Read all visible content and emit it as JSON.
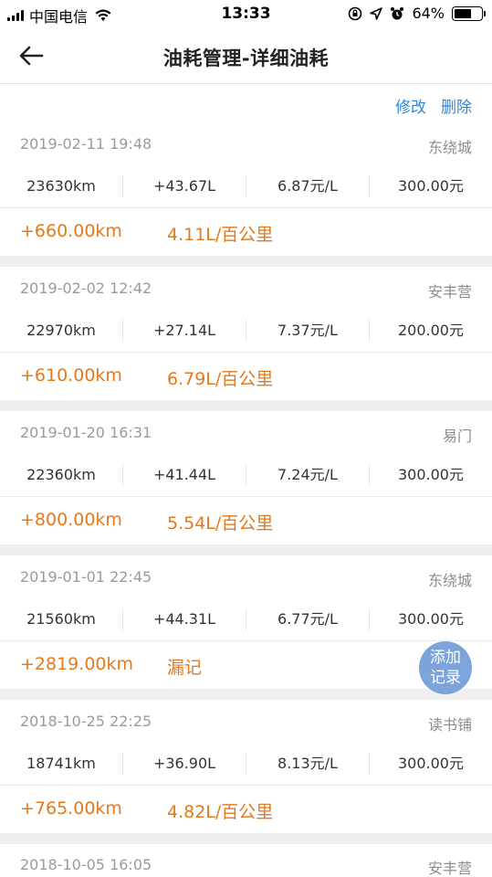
{
  "status_bar": {
    "carrier": "中国电信",
    "time": "13:33",
    "battery": "64%",
    "battery_level": 0.64
  },
  "header": {
    "title": "油耗管理-详细油耗"
  },
  "actions": {
    "edit": "修改",
    "delete": "删除"
  },
  "records": [
    {
      "datetime": "2019-02-11 19:48",
      "station": "东绕城",
      "odometer": "23630km",
      "fuel": "+43.67L",
      "price": "6.87元/L",
      "amount": "300.00元",
      "distance": "+660.00km",
      "consumption": "4.11L/百公里"
    },
    {
      "datetime": "2019-02-02 12:42",
      "station": "安丰营",
      "odometer": "22970km",
      "fuel": "+27.14L",
      "price": "7.37元/L",
      "amount": "200.00元",
      "distance": "+610.00km",
      "consumption": "6.79L/百公里"
    },
    {
      "datetime": "2019-01-20 16:31",
      "station": "易门",
      "odometer": "22360km",
      "fuel": "+41.44L",
      "price": "7.24元/L",
      "amount": "300.00元",
      "distance": "+800.00km",
      "consumption": "5.54L/百公里"
    },
    {
      "datetime": "2019-01-01 22:45",
      "station": "东绕城",
      "odometer": "21560km",
      "fuel": "+44.31L",
      "price": "6.77元/L",
      "amount": "300.00元",
      "distance": "+2819.00km",
      "consumption": "漏记"
    },
    {
      "datetime": "2018-10-25 22:25",
      "station": "读书铺",
      "odometer": "18741km",
      "fuel": "+36.90L",
      "price": "8.13元/L",
      "amount": "300.00元",
      "distance": "+765.00km",
      "consumption": "4.82L/百公里"
    },
    {
      "datetime": "2018-10-05 16:05",
      "station": "安丰营"
    }
  ],
  "fab": {
    "line1": "添加",
    "line2": "记录"
  },
  "colors": {
    "accent_blue": "#2f86d8",
    "orange": "#e27a1c",
    "fab": "#6e9bd8",
    "separator": "#efefef"
  }
}
